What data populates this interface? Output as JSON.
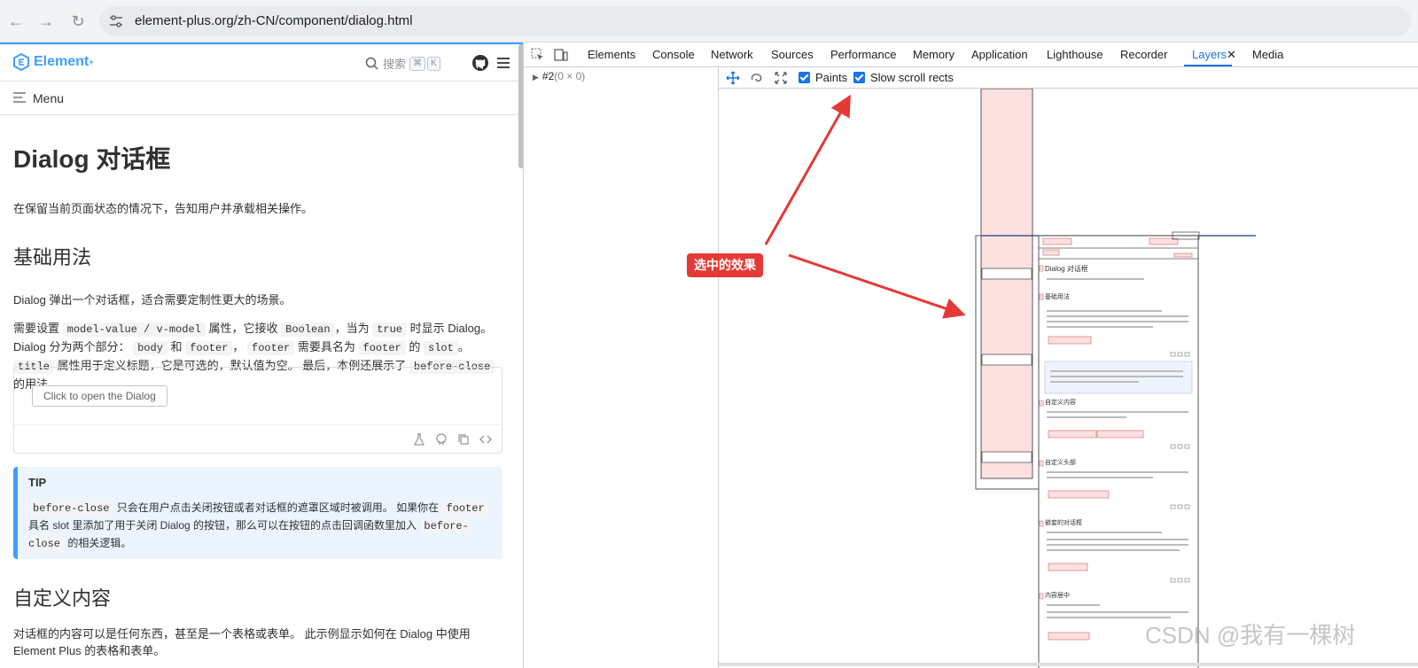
{
  "browser": {
    "url": "element-plus.org/zh-CN/component/dialog.html"
  },
  "page": {
    "logo_text": "Element",
    "logo_sup": "+",
    "search_label": "搜索",
    "kbd1": "⌘",
    "kbd2": "K",
    "menu_label": "Menu",
    "title": "Dialog 对话框",
    "intro": "在保留当前页面状态的情况下，告知用户并承载相关操作。",
    "h_basic": "基础用法",
    "basic_desc": "Dialog 弹出一个对话框，适合需要定制性更大的场景。",
    "p1_a": "需要设置",
    "p1_code1": "model-value / v-model",
    "p1_b": "属性，它接收",
    "p1_code2": "Boolean",
    "p1_c": "，当为",
    "p1_code3": "true",
    "p1_d": "时显示 Dialog。Dialog 分为两个部分：",
    "p1_code4": "body",
    "p1_e": "和",
    "p1_code5": "footer",
    "p1_f": "，",
    "p1_code6": "footer",
    "p1_g": "需要具名为",
    "p1_code7": "footer",
    "p1_h": "的",
    "p1_code8": "slot",
    "p1_i": "。",
    "p1_code9": "title",
    "p1_j": "属性用于定义标题，它是可选的，默认值为空。 最后，本例还展示了",
    "p1_code10": "before-close",
    "p1_k": "的用法。",
    "demo_button": "Click to open the Dialog",
    "tip_title": "TIP",
    "tip_code1": "before-close",
    "tip_a": "只会在用户点击关闭按钮或者对话框的遮罩区域时被调用。 如果你在",
    "tip_code2": "footer",
    "tip_b": "具名 slot 里添加了用于关闭 Dialog 的按钮，那么可以在按钮的点击回调函数里加入",
    "tip_code3": "before-close",
    "tip_c": "的相关逻辑。",
    "h_custom": "自定义内容",
    "custom_desc": "对话框的内容可以是任何东西，甚至是一个表格或表单。 此示例显示如何在 Dialog 中使用 Element Plus 的表格和表单。"
  },
  "devtools": {
    "tabs": [
      "Elements",
      "Console",
      "Network",
      "Sources",
      "Performance",
      "Memory",
      "Application",
      "Lighthouse",
      "Recorder",
      "Layers",
      "Media"
    ],
    "active_tab": "Layers",
    "tree_item": "#2",
    "tree_item_dim": "(0 × 0)",
    "paints_label": "Paints",
    "slow_scroll_label": "Slow scroll rects",
    "viewport_labels": {
      "dialog_title": "Dialog 对话框",
      "basic": "基础用法",
      "custom": "自定义内容",
      "custom_header": "自定义头部",
      "nested": "嵌套的对话框",
      "center": "内容居中"
    }
  },
  "annotation": {
    "label": "选中的效果"
  },
  "watermark": "CSDN @我有一棵树",
  "colors": {
    "accent": "#409eff",
    "devtools_blue": "#1a73e8",
    "annotation_red": "#e53935",
    "layer_fill": "#fde0e0"
  }
}
